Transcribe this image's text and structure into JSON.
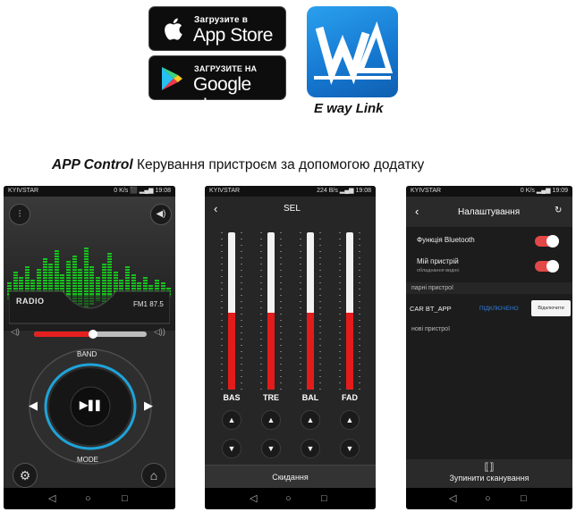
{
  "badges": {
    "appstore": {
      "small": "Загрузите в",
      "big": "App Store"
    },
    "googleplay": {
      "small": "ЗАГРУЗИТЕ НА",
      "big": "Google play"
    }
  },
  "app_logo": {
    "name": "E way Link",
    "mark": "WA"
  },
  "caption": {
    "bold": "APP Control",
    "text": " Керування пристроєм за допомогою додатку"
  },
  "phone1": {
    "status_left": "KYIVSTAR",
    "status_right": "0 K/s ⬛ ▂▄▆ 19:08",
    "mode_label": "RADIO",
    "frequency": "FM1  87.5",
    "volume_fraction": 0.52,
    "band_label": "BAND",
    "mode_button_label": "MODE",
    "play_pause_symbol": "▶❚❚",
    "prev_arrow": "◀",
    "next_arrow": "▶",
    "eq_levels": [
      0.25,
      0.45,
      0.35,
      0.55,
      0.3,
      0.5,
      0.7,
      0.6,
      0.85,
      0.4,
      0.65,
      0.75,
      0.5,
      0.9,
      0.55,
      0.35,
      0.6,
      0.8,
      0.45,
      0.3,
      0.55,
      0.4,
      0.25,
      0.35,
      0.2,
      0.3,
      0.25,
      0.15
    ],
    "colors": {
      "accent": "#e62020",
      "ring": "#1fa3d8",
      "eq": "#16c21c"
    }
  },
  "phone2": {
    "status_left": "KYIVSTAR",
    "status_right": "224 B/s ▂▄▆ 19:08",
    "title": "SEL",
    "sliders": [
      {
        "label": "BAS",
        "level": 0.49
      },
      {
        "label": "TRE",
        "level": 0.49
      },
      {
        "label": "BAL",
        "level": 0.49
      },
      {
        "label": "FAD",
        "level": 0.49
      }
    ],
    "up_symbol": "▲",
    "down_symbol": "▼",
    "reset_label": "Скидання"
  },
  "phone3": {
    "status_left": "KYIVSTAR",
    "status_right": "0 K/s ▂▄▆ 19:09",
    "title": "Налаштування",
    "bluetooth_label": "Функція Bluetooth",
    "my_device_label": "Мій пристрій",
    "my_device_sub": "обладнання видно",
    "paired_header": "парні пристрої",
    "device_name": "CAR BT_APP",
    "device_status": "ПІДКЛЮЧЕНО",
    "disconnect_label": "Відключити",
    "new_header": "нові пристрої",
    "stop_scan_label": "Зупинити сканування",
    "colors": {
      "toggle": "#e34848",
      "link": "#2f7fe0"
    }
  },
  "navbar": {
    "back": "◁",
    "home": "○",
    "recent": "□"
  }
}
